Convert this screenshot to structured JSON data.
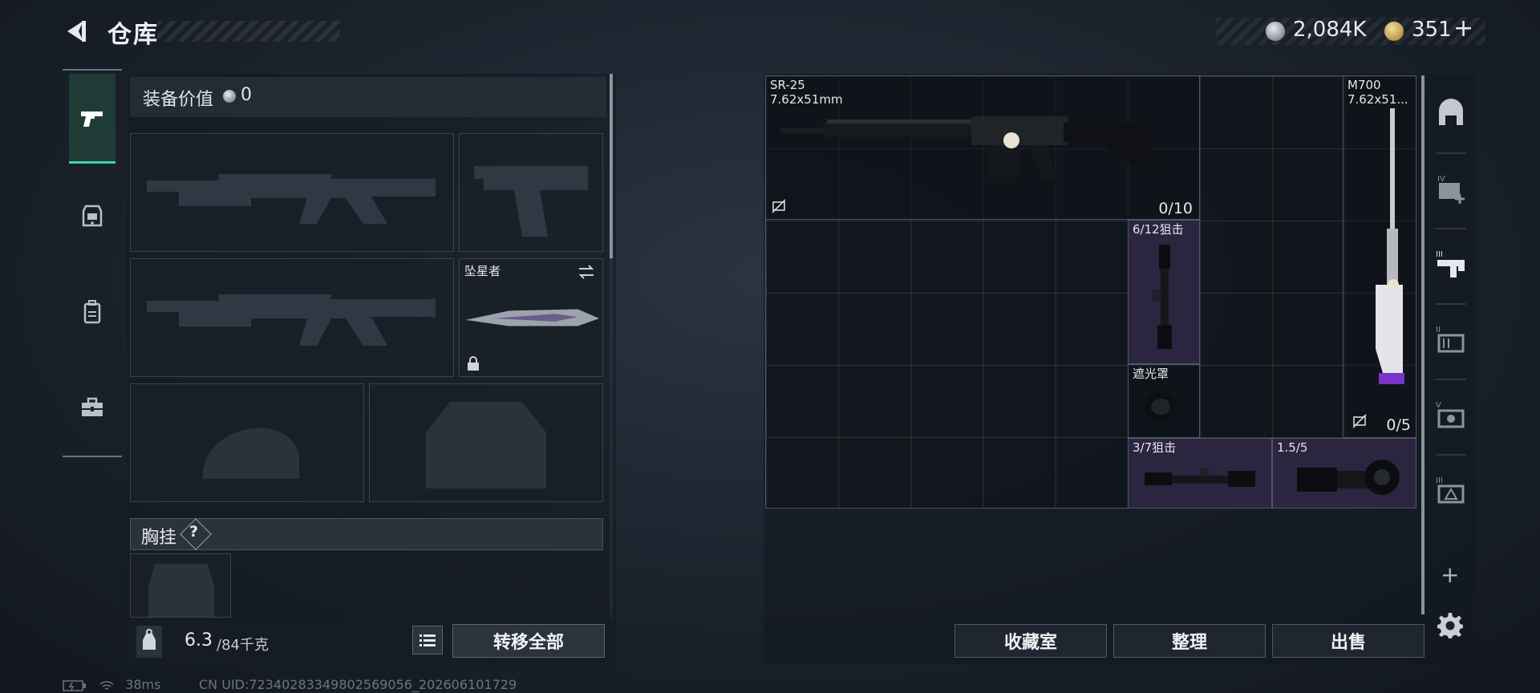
{
  "header": {
    "title": "仓库",
    "currency": {
      "silver": "2,084K",
      "gold": "351",
      "gold_add": "+"
    }
  },
  "left_tabs": [
    {
      "name": "weapons",
      "active": true
    },
    {
      "name": "armor",
      "active": false
    },
    {
      "name": "backpack",
      "active": false
    },
    {
      "name": "toolbox",
      "active": false
    }
  ],
  "equipment": {
    "label": "装备价值",
    "value": "0",
    "melee": {
      "name": "坠星者"
    },
    "chest": {
      "label": "胸挂",
      "help": "?"
    }
  },
  "capacity": {
    "current": "6.3",
    "max": "/84千克",
    "transfer_label": "转移全部"
  },
  "status": {
    "ping": "38ms",
    "uid": "CN UID:72340283349802569056_202606101729"
  },
  "stash": {
    "items": [
      {
        "name": "SR-25",
        "sub": "7.62x51mm",
        "count": "0/10"
      },
      {
        "name": "M700",
        "sub": "7.62x51...",
        "count": "0/5"
      },
      {
        "name": "6/12狙击"
      },
      {
        "name": "遮光罩"
      },
      {
        "name": "3/7狙击"
      },
      {
        "name": "1.5/5"
      }
    ]
  },
  "actions": {
    "collection": "收藏室",
    "sort": "整理",
    "sell": "出售"
  },
  "colors": {
    "accent": "#3fd3a6",
    "purple_item": "#2c2540",
    "background": "#1b222c"
  }
}
